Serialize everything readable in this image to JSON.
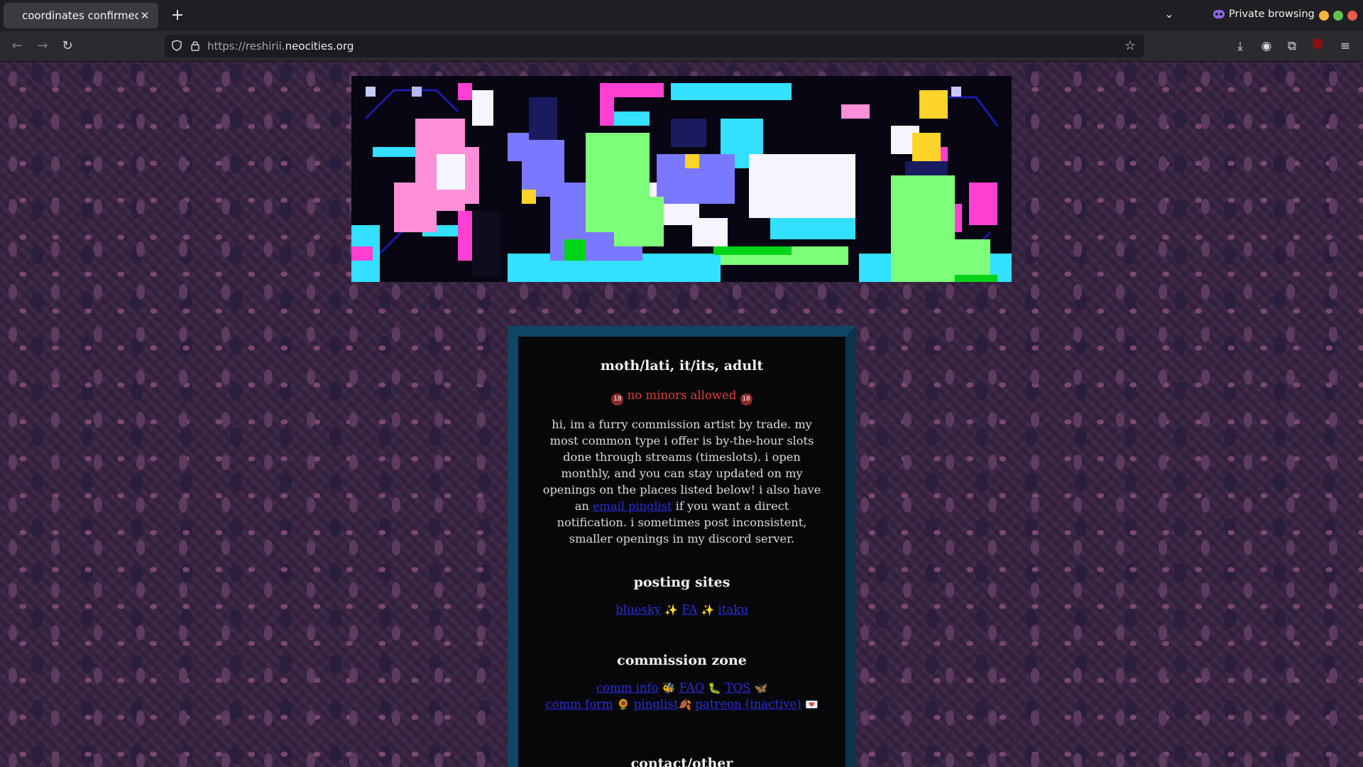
{
  "browser": {
    "tab_title": "coordinates confirmed",
    "url_prefix": "https://reshirii.",
    "url_domain": "neocities.org",
    "private_label": "Private browsing",
    "icons": [
      "back-icon",
      "forward-icon",
      "reload-icon",
      "shield-icon",
      "lock-icon",
      "star-icon",
      "download-icon",
      "account-icon",
      "extensions-icon",
      "ublock-icon",
      "menu-icon"
    ]
  },
  "page": {
    "name_heading": "moth/lati, it/its, adult",
    "warning": "no minors allowed",
    "warning_badge": "18",
    "bio_part1": "hi, im a furry commission artist by trade. my most common type i offer is by-the-hour slots done through streams (timeslots). i open monthly, and you can stay updated on my openings on the places listed below! i also have an ",
    "bio_link": "email pinglist",
    "bio_part2": " if you want a direct notification. i sometimes post inconsistent, smaller openings in my discord server.",
    "posting_heading": "posting sites",
    "posting_links": [
      "bluesky",
      "FA",
      "itaku"
    ],
    "posting_sep": "✨",
    "commission_heading": "commission zone",
    "commission_row1": [
      "comm info",
      "FAQ",
      "TOS"
    ],
    "commission_row1_emoji": [
      "🐝",
      "🐛",
      "🦋"
    ],
    "commission_row2": [
      "comm form",
      "pinglist",
      "patreon (inactive)"
    ],
    "commission_row2_emoji": [
      "🌻",
      "🍂",
      "💌"
    ],
    "contact_heading": "contact/other"
  },
  "colors": {
    "link": "#2b2bd9",
    "warning": "#e23a3a",
    "panel_border": "#104564",
    "panel_bg": "#07070a"
  }
}
